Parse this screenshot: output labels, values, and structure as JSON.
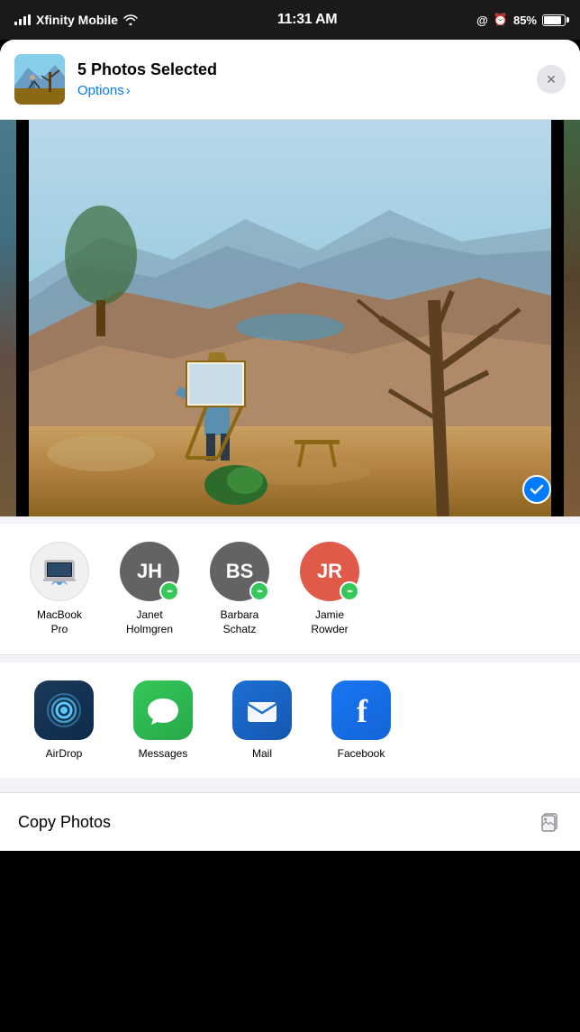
{
  "statusBar": {
    "carrier": "Xfinity Mobile",
    "time": "11:31 AM",
    "battery": "85%"
  },
  "shareHeader": {
    "title": "5 Photos Selected",
    "options": "Options",
    "optionsArrow": "›",
    "closeLabel": "✕"
  },
  "people": [
    {
      "id": "macbook",
      "initials": "",
      "name": "MacBook\nPro",
      "type": "device"
    },
    {
      "id": "jh",
      "initials": "JH",
      "name": "Janet\nHolmgren",
      "type": "contact"
    },
    {
      "id": "bs",
      "initials": "BS",
      "name": "Barbara\nSchatz",
      "type": "contact"
    },
    {
      "id": "jr",
      "initials": "JR",
      "name": "Jamie\nRowder",
      "type": "contact"
    }
  ],
  "apps": [
    {
      "id": "airdrop",
      "name": "AirDrop"
    },
    {
      "id": "messages",
      "name": "Messages"
    },
    {
      "id": "mail",
      "name": "Mail"
    },
    {
      "id": "facebook",
      "name": "Facebook"
    }
  ],
  "copyRow": {
    "label": "Copy Photos"
  },
  "checkmark": "✓"
}
